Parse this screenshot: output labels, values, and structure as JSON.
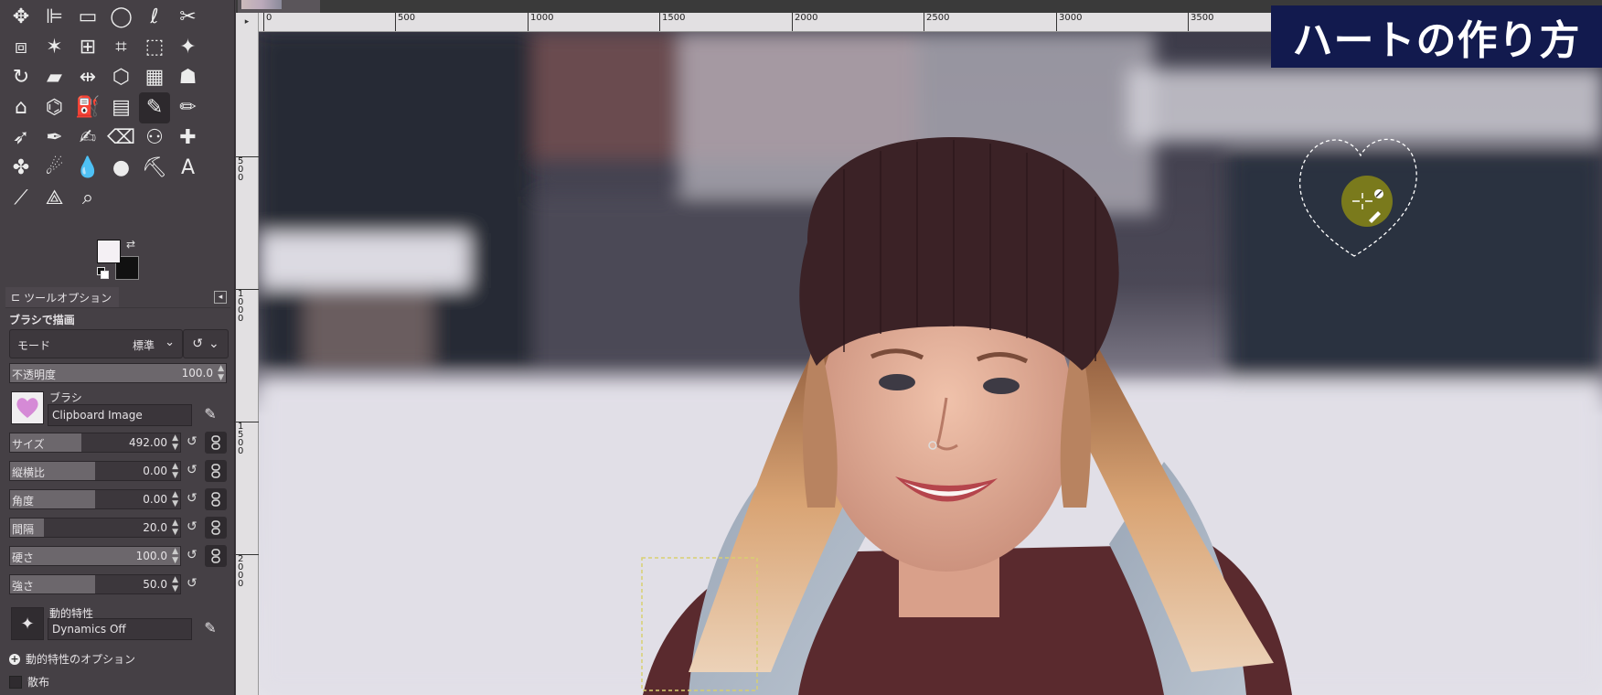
{
  "title_badge": "ハートの作り方",
  "toolbox": {
    "tools": [
      {
        "name": "move-tool-icon",
        "glyph": "✥"
      },
      {
        "name": "align-tool-icon",
        "glyph": "⊫"
      },
      {
        "name": "rect-select-tool-icon",
        "glyph": "▭"
      },
      {
        "name": "ellipse-select-tool-icon",
        "glyph": "◯"
      },
      {
        "name": "free-select-tool-icon",
        "glyph": "ℓ"
      },
      {
        "name": "scissors-select-tool-icon",
        "glyph": "✂"
      },
      {
        "name": "foreground-select-tool-icon",
        "glyph": "⧈"
      },
      {
        "name": "fuzzy-select-tool-icon",
        "glyph": "✶"
      },
      {
        "name": "select-by-color-tool-icon",
        "glyph": "⊞"
      },
      {
        "name": "crop-tool-icon",
        "glyph": "⌗"
      },
      {
        "name": "unified-transform-tool-icon",
        "glyph": "⬚"
      },
      {
        "name": "warp-transform-tool-icon",
        "glyph": "✦"
      },
      {
        "name": "rotate-tool-icon",
        "glyph": "↻"
      },
      {
        "name": "shear-tool-icon",
        "glyph": "▰"
      },
      {
        "name": "flip-tool-icon",
        "glyph": "⇹"
      },
      {
        "name": "perspective-tool-icon",
        "glyph": "⬡"
      },
      {
        "name": "3d-transform-tool-icon",
        "glyph": "▦"
      },
      {
        "name": "cage-transform-tool-icon",
        "glyph": "☗"
      },
      {
        "name": "handle-transform-tool-icon",
        "glyph": "⌂"
      },
      {
        "name": "path-tool-icon",
        "glyph": "⌬"
      },
      {
        "name": "bucket-fill-tool-icon",
        "glyph": "⛽"
      },
      {
        "name": "gradient-tool-icon",
        "glyph": "▤"
      },
      {
        "name": "paintbrush-tool-icon",
        "glyph": "✎",
        "active": true
      },
      {
        "name": "pencil-tool-icon",
        "glyph": "✏"
      },
      {
        "name": "airbrush-tool-icon",
        "glyph": "➶"
      },
      {
        "name": "ink-tool-icon",
        "glyph": "✒"
      },
      {
        "name": "mypaint-brush-tool-icon",
        "glyph": "✍"
      },
      {
        "name": "eraser-tool-icon",
        "glyph": "⌫"
      },
      {
        "name": "clone-tool-icon",
        "glyph": "⚇"
      },
      {
        "name": "heal-tool-icon",
        "glyph": "✚"
      },
      {
        "name": "perspective-clone-tool-icon",
        "glyph": "✤"
      },
      {
        "name": "smudge-tool-icon",
        "glyph": "☄"
      },
      {
        "name": "blur-tool-icon",
        "glyph": "💧"
      },
      {
        "name": "dodge-burn-tool-icon",
        "glyph": "●"
      },
      {
        "name": "text-path-tool-icon",
        "glyph": "⛏"
      },
      {
        "name": "text-tool-icon",
        "glyph": "A"
      },
      {
        "name": "color-picker-tool-icon",
        "glyph": "⟋"
      },
      {
        "name": "measure-tool-icon",
        "glyph": "⟁"
      },
      {
        "name": "zoom-tool-icon",
        "glyph": "⌕"
      }
    ]
  },
  "tool_options": {
    "tab_label": "ツールオプション",
    "tool_name": "ブラシで描画",
    "mode_label": "モード",
    "mode_value": "標準",
    "opacity_label": "不透明度",
    "opacity_value": "100.0",
    "brush_label": "ブラシ",
    "brush_name": "Clipboard Image",
    "sliders": [
      {
        "label": "サイズ",
        "value": "492.00",
        "fraction": 0.42
      },
      {
        "label": "縦横比",
        "value": "0.00",
        "fraction": 0.5
      },
      {
        "label": "角度",
        "value": "0.00",
        "fraction": 0.5
      },
      {
        "label": "間隔",
        "value": "20.0",
        "fraction": 0.2
      },
      {
        "label": "硬さ",
        "value": "100.0",
        "fraction": 1.0
      },
      {
        "label": "強さ",
        "value": "50.0",
        "fraction": 0.5
      }
    ],
    "dynamics_label": "動的特性",
    "dynamics_name": "Dynamics Off",
    "dynamics_options_label": "動的特性のオプション",
    "scatter_label": "散布"
  },
  "rulers": {
    "h_ticks": [
      "0",
      "500",
      "1000",
      "1500",
      "2000",
      "2500",
      "3000",
      "3500"
    ],
    "v_ticks": [
      "500",
      "1000",
      "1500",
      "2000"
    ]
  },
  "colors": {
    "foreground": "#f4f0f4",
    "background": "#111111",
    "badge": "#121a4e"
  }
}
